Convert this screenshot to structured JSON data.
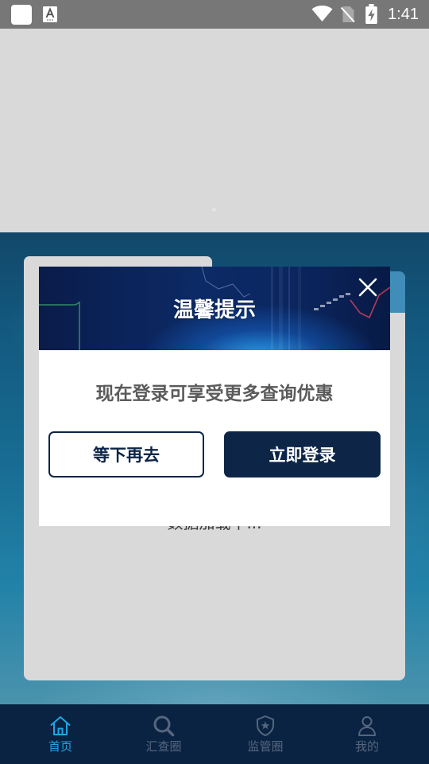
{
  "status_bar": {
    "time": "1:41",
    "icons": [
      "app-notification-icon",
      "keyboard-a-icon",
      "wifi-icon",
      "no-sim-icon",
      "battery-charging-icon"
    ]
  },
  "background_page": {
    "loading_text": "数据加载中..."
  },
  "dialog": {
    "title": "温馨提示",
    "message": "现在登录可享受更多查询优惠",
    "close_icon": "close-icon",
    "cancel_label": "等下再去",
    "confirm_label": "立即登录"
  },
  "bottom_nav": {
    "items": [
      {
        "label": "首页",
        "icon": "home-icon",
        "active": true
      },
      {
        "label": "汇查圈",
        "icon": "search-icon",
        "active": false
      },
      {
        "label": "监管圈",
        "icon": "police-badge-icon",
        "active": false
      },
      {
        "label": "我的",
        "icon": "user-icon",
        "active": false
      }
    ]
  },
  "colors": {
    "primary_navy": "#0d2547",
    "nav_background": "#0a2342",
    "nav_active": "#1ea7e4",
    "nav_inactive": "#56667e",
    "status_bar": "#777777",
    "dimmed_page": "#d9d9d9"
  }
}
